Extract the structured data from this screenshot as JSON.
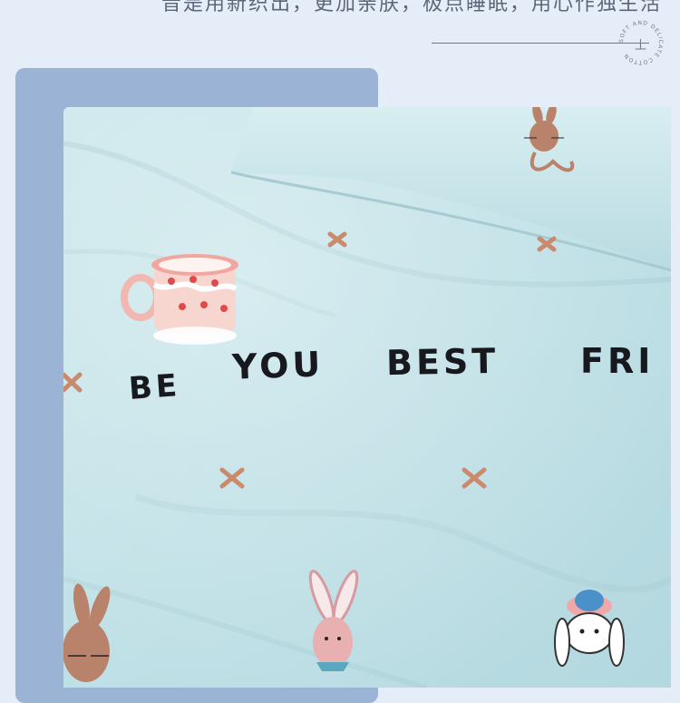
{
  "header": {
    "caption": "音是用新织出，更加亲肤，极点睡眠，用心作独生活",
    "seal_text": "SOFT AND DELICATE COTTON",
    "seal_mark": "土"
  },
  "photo": {
    "embroidery_words": [
      "BE",
      "YOU",
      "BEST",
      "FRI"
    ]
  },
  "colors": {
    "background": "#e4edf8",
    "panel": "#9bb3d4",
    "fabric": "#bfe0e6",
    "embroidery_thread": "#17191f",
    "cross_stitch": "#c98a6e"
  }
}
